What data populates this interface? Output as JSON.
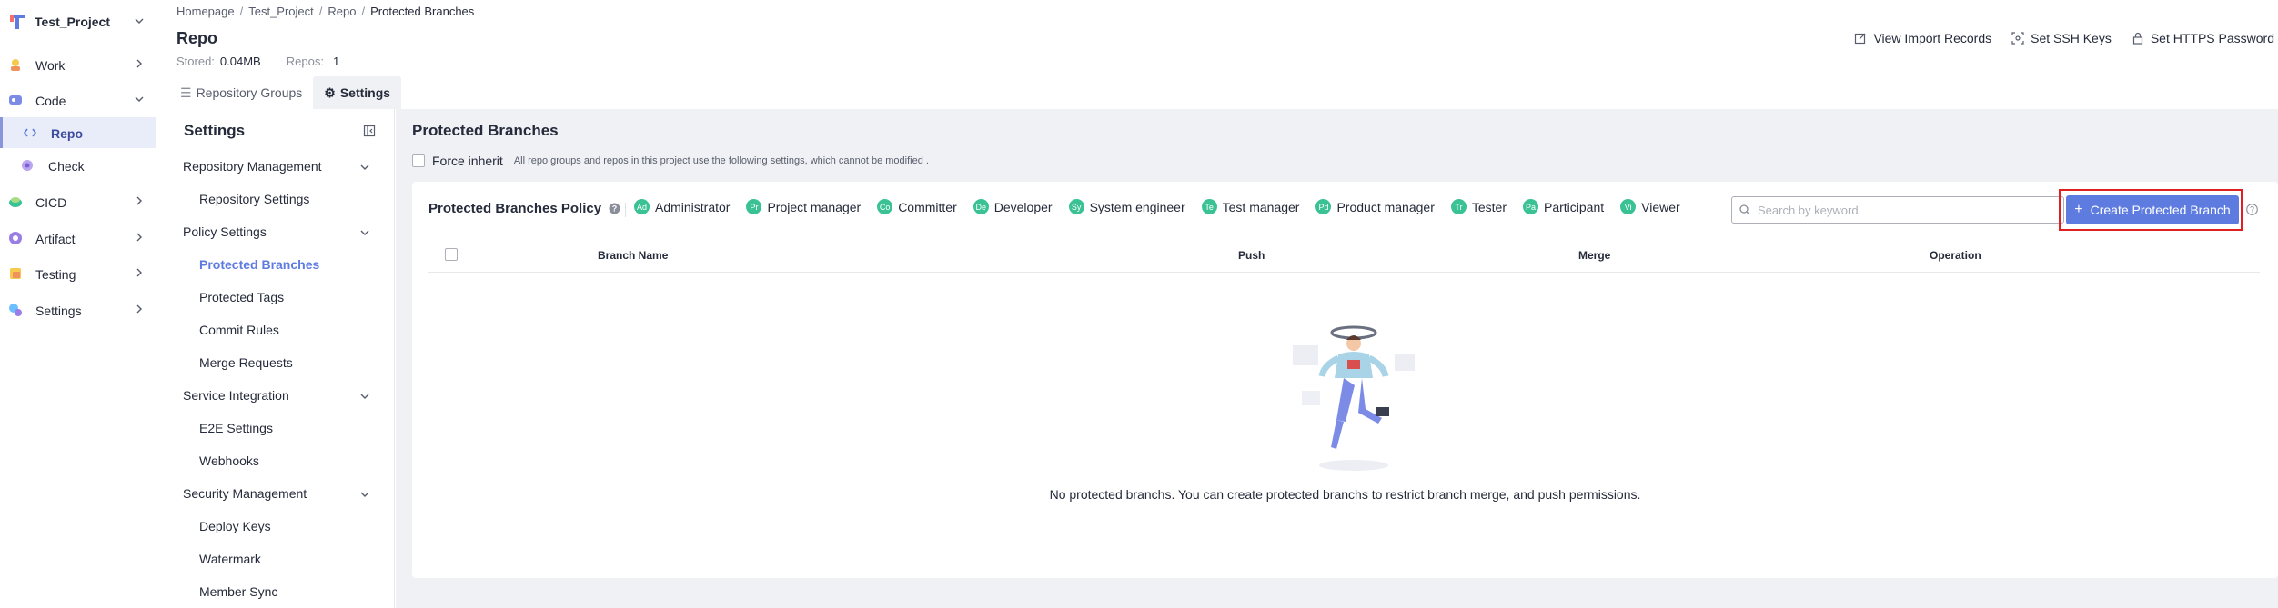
{
  "project": {
    "name": "Test_Project"
  },
  "nav": {
    "items": [
      {
        "label": "Work",
        "icon": "work-icon"
      },
      {
        "label": "Code",
        "icon": "code-icon"
      },
      {
        "label": "CICD",
        "icon": "cicd-icon"
      },
      {
        "label": "Artifact",
        "icon": "artifact-icon"
      },
      {
        "label": "Testing",
        "icon": "testing-icon"
      },
      {
        "label": "Settings",
        "icon": "settings-icon"
      }
    ],
    "code_sub": [
      {
        "label": "Repo",
        "active": true
      },
      {
        "label": "Check",
        "active": false
      }
    ]
  },
  "breadcrumb": [
    "Homepage",
    "Test_Project",
    "Repo",
    "Protected Branches"
  ],
  "header": {
    "title": "Repo",
    "stored_label": "Stored:",
    "stored_value": "0.04MB",
    "repos_label": "Repos:",
    "repos_value": "1",
    "actions": [
      "View Import Records",
      "Set SSH Keys",
      "Set HTTPS Password"
    ]
  },
  "tabs": [
    {
      "label": "Repository Groups",
      "active": false
    },
    {
      "label": "Settings",
      "active": true
    }
  ],
  "settings_menu": {
    "title": "Settings",
    "groups": [
      {
        "label": "Repository Management",
        "items": [
          "Repository Settings"
        ]
      },
      {
        "label": "Policy Settings",
        "items": [
          "Protected Branches",
          "Protected Tags",
          "Commit Rules",
          "Merge Requests"
        ]
      },
      {
        "label": "Service Integration",
        "items": [
          "E2E Settings",
          "Webhooks"
        ]
      },
      {
        "label": "Security Management",
        "items": [
          "Deploy Keys",
          "Watermark",
          "Member Sync"
        ]
      }
    ],
    "active_item": "Protected Branches"
  },
  "main": {
    "title": "Protected Branches",
    "force_inherit_label": "Force inherit",
    "force_inherit_note": "All repo groups and repos in this project use the following settings, which cannot be modified .",
    "policy_title": "Protected Branches Policy",
    "roles": [
      {
        "abbr": "Ad",
        "label": "Administrator"
      },
      {
        "abbr": "Pr",
        "label": "Project manager"
      },
      {
        "abbr": "Co",
        "label": "Committer"
      },
      {
        "abbr": "De",
        "label": "Developer"
      },
      {
        "abbr": "Sy",
        "label": "System engineer"
      },
      {
        "abbr": "Te",
        "label": "Test manager"
      },
      {
        "abbr": "Pd",
        "label": "Product manager"
      },
      {
        "abbr": "Tr",
        "label": "Tester"
      },
      {
        "abbr": "Pa",
        "label": "Participant"
      },
      {
        "abbr": "Vi",
        "label": "Viewer"
      }
    ],
    "search_placeholder": "Search by keyword.",
    "create_button": "Create Protected Branch",
    "columns": [
      "Branch Name",
      "Push",
      "Merge",
      "Operation"
    ],
    "empty_text": "No protected branchs. You can create protected branchs to restrict branch merge, and push permissions."
  },
  "colors": {
    "primary": "#5e7ce0",
    "role_avatar": "#3ac295",
    "highlight": "#e02020"
  }
}
